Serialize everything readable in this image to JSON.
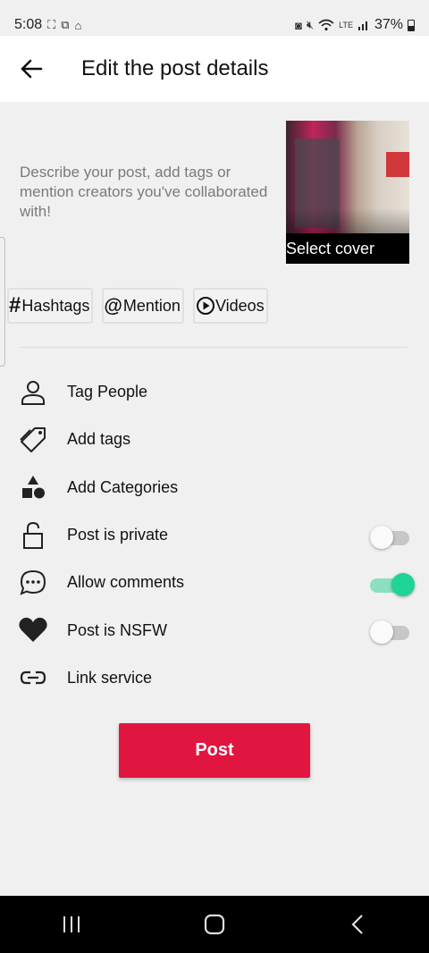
{
  "status_bar": {
    "time": "5:08",
    "battery_percent": "37%",
    "left_icons": [
      "screenshot-icon",
      "scan-icon",
      "home-app-icon"
    ],
    "right_icons": [
      "app-icon",
      "mute-icon",
      "wifi-icon",
      "volte-icon",
      "signal-icon",
      "battery-icon"
    ]
  },
  "header": {
    "title": "Edit the post details",
    "back_icon": "arrow-left-icon"
  },
  "post": {
    "description_placeholder": "Describe your post, add tags or mention creators you've collaborated with!",
    "cover_label": "Select cover"
  },
  "chips": [
    {
      "icon": "#",
      "label": "Hashtags"
    },
    {
      "icon": "@",
      "label": "Mention"
    },
    {
      "icon": "play-circle-icon",
      "label": "Videos"
    }
  ],
  "options": [
    {
      "icon": "person-icon",
      "label": "Tag People"
    },
    {
      "icon": "tag-icon",
      "label": "Add tags"
    },
    {
      "icon": "shapes-icon",
      "label": "Add Categories"
    },
    {
      "icon": "lock-open-icon",
      "label": "Post is private",
      "toggle": false
    },
    {
      "icon": "comment-icon",
      "label": "Allow comments",
      "toggle": true
    },
    {
      "icon": "heart-icon",
      "label": "Post is NSFW",
      "toggle": false
    },
    {
      "icon": "link-icon",
      "label": "Link service"
    }
  ],
  "actions": {
    "post_label": "Post"
  },
  "colors": {
    "accent": "#e01540",
    "toggle_on": "#1fd497",
    "background": "#f0f0f0"
  },
  "nav": [
    "recents-icon",
    "home-icon",
    "back-icon"
  ]
}
